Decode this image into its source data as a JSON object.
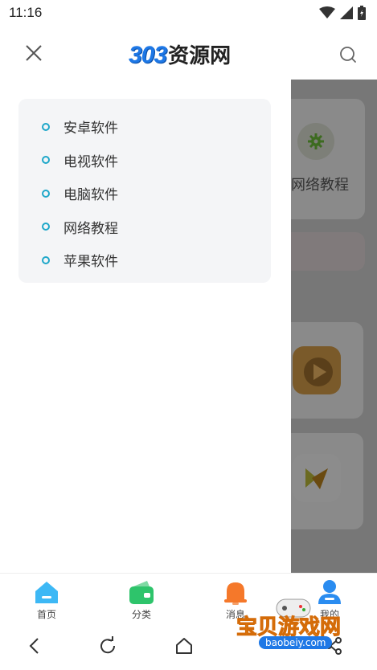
{
  "status_bar": {
    "time": "11:16",
    "icons": [
      "wifi-icon",
      "signal-icon",
      "battery-icon"
    ]
  },
  "header": {
    "logo_number": "303",
    "logo_text": "资源网",
    "close_icon": "close-icon",
    "search_icon": "search-icon"
  },
  "menu": {
    "items": [
      {
        "label": "安卓软件"
      },
      {
        "label": "电视软件"
      },
      {
        "label": "电脑软件"
      },
      {
        "label": "网络教程"
      },
      {
        "label": "苹果软件"
      }
    ]
  },
  "background_page": {
    "card_label": "网络教程"
  },
  "tabs": [
    {
      "label": "首页",
      "icon": "home-icon",
      "color": "#3db8f5"
    },
    {
      "label": "分类",
      "icon": "wallet-icon",
      "color": "#2ec46b"
    },
    {
      "label": "消息",
      "icon": "bell-icon",
      "color": "#f5782a"
    },
    {
      "label": "我的",
      "icon": "user-icon",
      "color": "#2a8cf0"
    }
  ],
  "nav": {
    "back": "back-icon",
    "refresh": "refresh-icon",
    "home": "home-nav-icon",
    "share": "share-icon"
  },
  "watermark": {
    "text": "宝贝游戏网",
    "url": "baobeiy.com"
  },
  "colors": {
    "accent": "#1ea7c9",
    "logo_blue": "#1e78e6",
    "menu_bg": "#f4f5f7"
  }
}
